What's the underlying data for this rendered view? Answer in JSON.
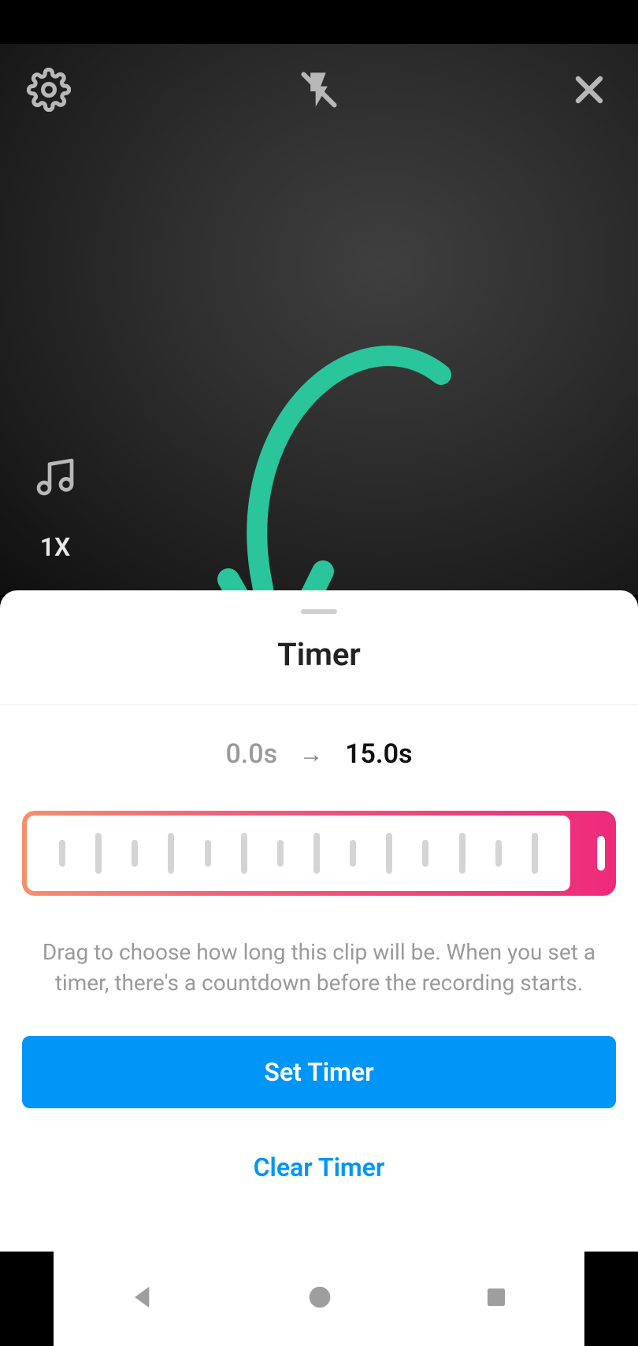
{
  "header": {
    "settings_icon": "gear",
    "flash_icon": "flash-off",
    "close_icon": "close"
  },
  "side": {
    "music_icon": "music",
    "speed_label": "1X"
  },
  "annotation": {
    "arrow_color": "#2ac59b"
  },
  "timer_sheet": {
    "title": "Timer",
    "time_start": "0.0s",
    "time_arrow": "→",
    "time_end": "15.0s",
    "help_text": "Drag to choose how long this clip will be. When you set a timer, there's a countdown before the recording starts.",
    "set_button_label": "Set Timer",
    "clear_button_label": "Clear Timer"
  },
  "colors": {
    "accent_blue": "#0095f6",
    "gradient_start": "#f78f6b",
    "gradient_end": "#ee2a7b"
  }
}
